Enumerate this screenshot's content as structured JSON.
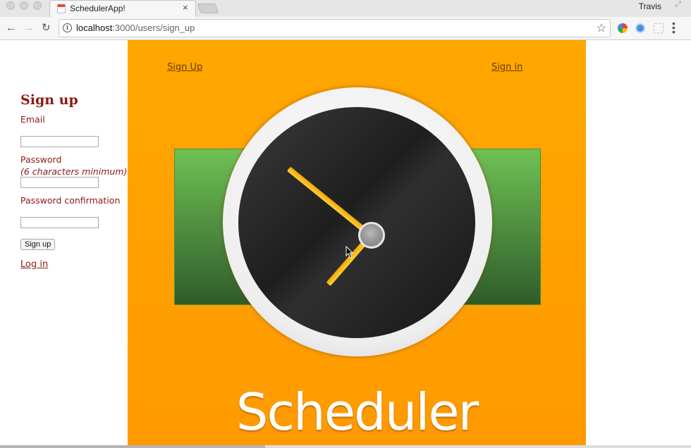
{
  "browser": {
    "tab_title": "SchedulerApp!",
    "tab_close": "×",
    "profile_name": "Travis",
    "url_host": "localhost",
    "url_path": ":3000/users/sign_up",
    "info_glyph": "i",
    "back_glyph": "←",
    "forward_glyph": "→",
    "reload_glyph": "↻",
    "star_glyph": "☆",
    "menu_glyph": "⋮",
    "fullscreen_glyph": "⤢"
  },
  "form": {
    "heading": "Sign up",
    "email_label": "Email",
    "email_value": "",
    "password_label": "Password",
    "password_hint": "(6 characters minimum)",
    "password_value": "",
    "confirmation_label": "Password confirmation",
    "confirmation_value": "",
    "submit_label": "Sign up",
    "login_link": "Log in"
  },
  "hero": {
    "nav_signup": "Sign Up",
    "nav_signin": "Sign in",
    "brand_text": "Scheduler",
    "background_color": "#ffa200",
    "band_color": "#5fae48"
  },
  "colors": {
    "form_text": "#8b1a12",
    "clock_hand": "#f7c12a"
  }
}
